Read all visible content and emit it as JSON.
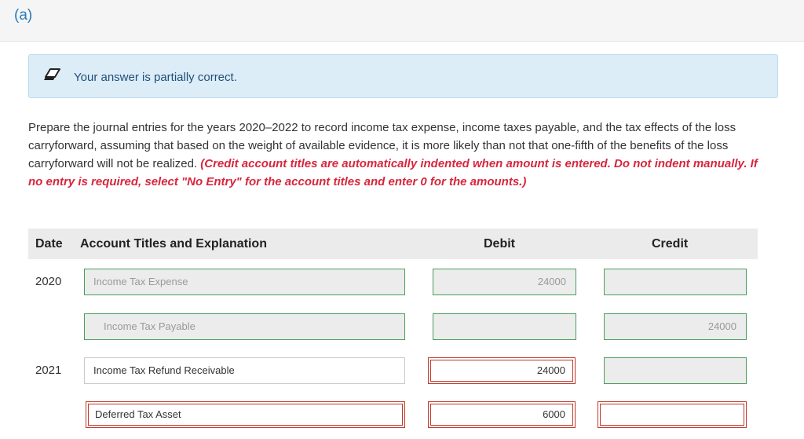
{
  "part": {
    "label": "(a)"
  },
  "feedback": {
    "icon": "pencil-eraser-icon",
    "text": "Your answer is partially correct."
  },
  "question": {
    "text": "Prepare the journal entries for the years 2020–2022 to record income tax expense, income taxes payable, and the tax effects of the loss carryforward, assuming that based on the weight of available evidence, it is more likely than not that one-fifth of the benefits of the loss carryforward will not be realized. ",
    "instruction": "(Credit account titles are automatically indented when amount is entered. Do not indent manually. If no entry is required, select \"No Entry\" for the account titles and enter 0 for the amounts.)"
  },
  "table": {
    "headers": {
      "date": "Date",
      "account": "Account Titles and Explanation",
      "debit": "Debit",
      "credit": "Credit"
    },
    "rows": [
      {
        "date": "2020",
        "account": "Income Tax Expense",
        "debit": "24000",
        "credit": ""
      },
      {
        "date": "",
        "account": "Income Tax Payable",
        "debit": "",
        "credit": "24000"
      },
      {
        "date": "2021",
        "account": "Income Tax Refund Receivable",
        "debit": "24000",
        "credit": ""
      },
      {
        "date": "",
        "account": "Deferred Tax Asset",
        "debit": "6000",
        "credit": ""
      }
    ]
  },
  "colors": {
    "correct_border": "#4a9e5c",
    "error_border": "#c0392b",
    "instruction_red": "#d7263d",
    "feedback_bg": "#dcedf7"
  }
}
